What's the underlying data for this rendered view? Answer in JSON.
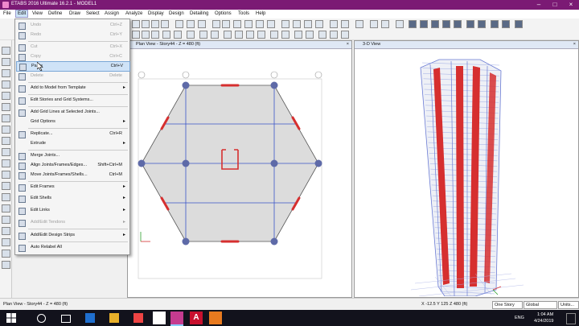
{
  "window": {
    "title": "ETABS 2016 Ultimate 16.2.1 - MODEL1"
  },
  "menubar": {
    "items": [
      "File",
      "Edit",
      "View",
      "Define",
      "Draw",
      "Select",
      "Assign",
      "Analyze",
      "Display",
      "Design",
      "Detailing",
      "Options",
      "Tools",
      "Help"
    ]
  },
  "edit_menu": {
    "undo": {
      "label": "Undo",
      "shortcut": "Ctrl+Z"
    },
    "redo": {
      "label": "Redo",
      "shortcut": "Ctrl+Y"
    },
    "cut": {
      "label": "Cut",
      "shortcut": "Ctrl+X"
    },
    "copy": {
      "label": "Copy",
      "shortcut": "Ctrl+C"
    },
    "paste": {
      "label": "Paste",
      "shortcut": "Ctrl+V"
    },
    "delete": {
      "label": "Delete",
      "shortcut": "Delete"
    },
    "add_template": {
      "label": "Add to Model from Template"
    },
    "edit_stories": {
      "label": "Edit Stories and Grid Systems..."
    },
    "add_grid": {
      "label": "Add Grid Lines at Selected Joints..."
    },
    "grid_options": {
      "label": "Grid Options"
    },
    "replicate": {
      "label": "Replicate...",
      "shortcut": "Ctrl+R"
    },
    "extrude": {
      "label": "Extrude"
    },
    "merge": {
      "label": "Merge Joints..."
    },
    "align": {
      "label": "Align Joints/Frames/Edges...",
      "shortcut": "Shift+Ctrl+M"
    },
    "move": {
      "label": "Move Joints/Frames/Shells...",
      "shortcut": "Ctrl+M"
    },
    "edit_frames": {
      "label": "Edit Frames"
    },
    "edit_shells": {
      "label": "Edit Shells"
    },
    "edit_links": {
      "label": "Edit Links"
    },
    "add_tendons": {
      "label": "Add/Edit Tendons"
    },
    "add_strips": {
      "label": "Add/Edit Design Strips"
    },
    "auto_relabel": {
      "label": "Auto Relabel All"
    }
  },
  "panels": {
    "plan": {
      "title": "Plan View - Story44 - Z = 480 (ft)"
    },
    "view3d": {
      "title": "3-D View"
    }
  },
  "status": {
    "left": "Plan View - Story44 - Z = 480 (ft)",
    "coords": "X -12.5  Y 125  Z 480 (ft)",
    "story": "One Story",
    "coord_sys": "Global",
    "units": "Units..."
  },
  "taskbar": {
    "time": "1:04 AM",
    "date": "4/24/2019",
    "lang": "ENG"
  },
  "colors": {
    "title_bar": "#7b1a74",
    "highlight": "#cfe3f7",
    "shear_wall": "#d62f2f",
    "grid": "#3a54c9"
  }
}
